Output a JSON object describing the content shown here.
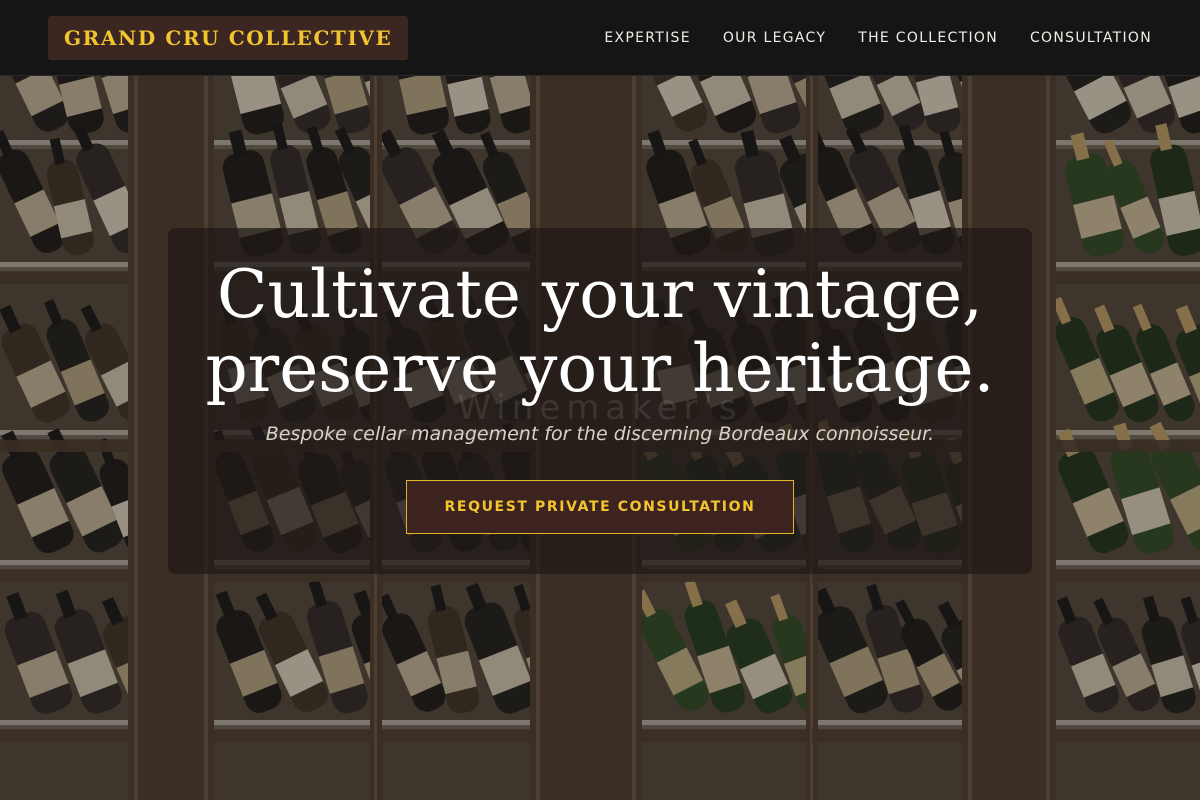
{
  "brand": {
    "name": "GRAND CRU COLLECTIVE"
  },
  "nav": {
    "items": [
      {
        "label": "EXPERTISE"
      },
      {
        "label": "OUR LEGACY"
      },
      {
        "label": "THE COLLECTION"
      },
      {
        "label": "CONSULTATION"
      }
    ]
  },
  "hero": {
    "title_line1": "Cultivate your vintage,",
    "title_line2": "preserve your heritage.",
    "subtitle": "Bespoke cellar management for the discerning Bordeaux connoisseur.",
    "cta_label": "REQUEST PRIVATE CONSULTATION",
    "background_image": "wine-cellar-photo",
    "ghost_wordmark": "Winemaker's"
  },
  "colors": {
    "accent_gold": "#f2c52e",
    "logo_background": "#3b2622",
    "header_background": "#151515",
    "cta_background": "#3d231f",
    "hero_panel": "#201916"
  }
}
